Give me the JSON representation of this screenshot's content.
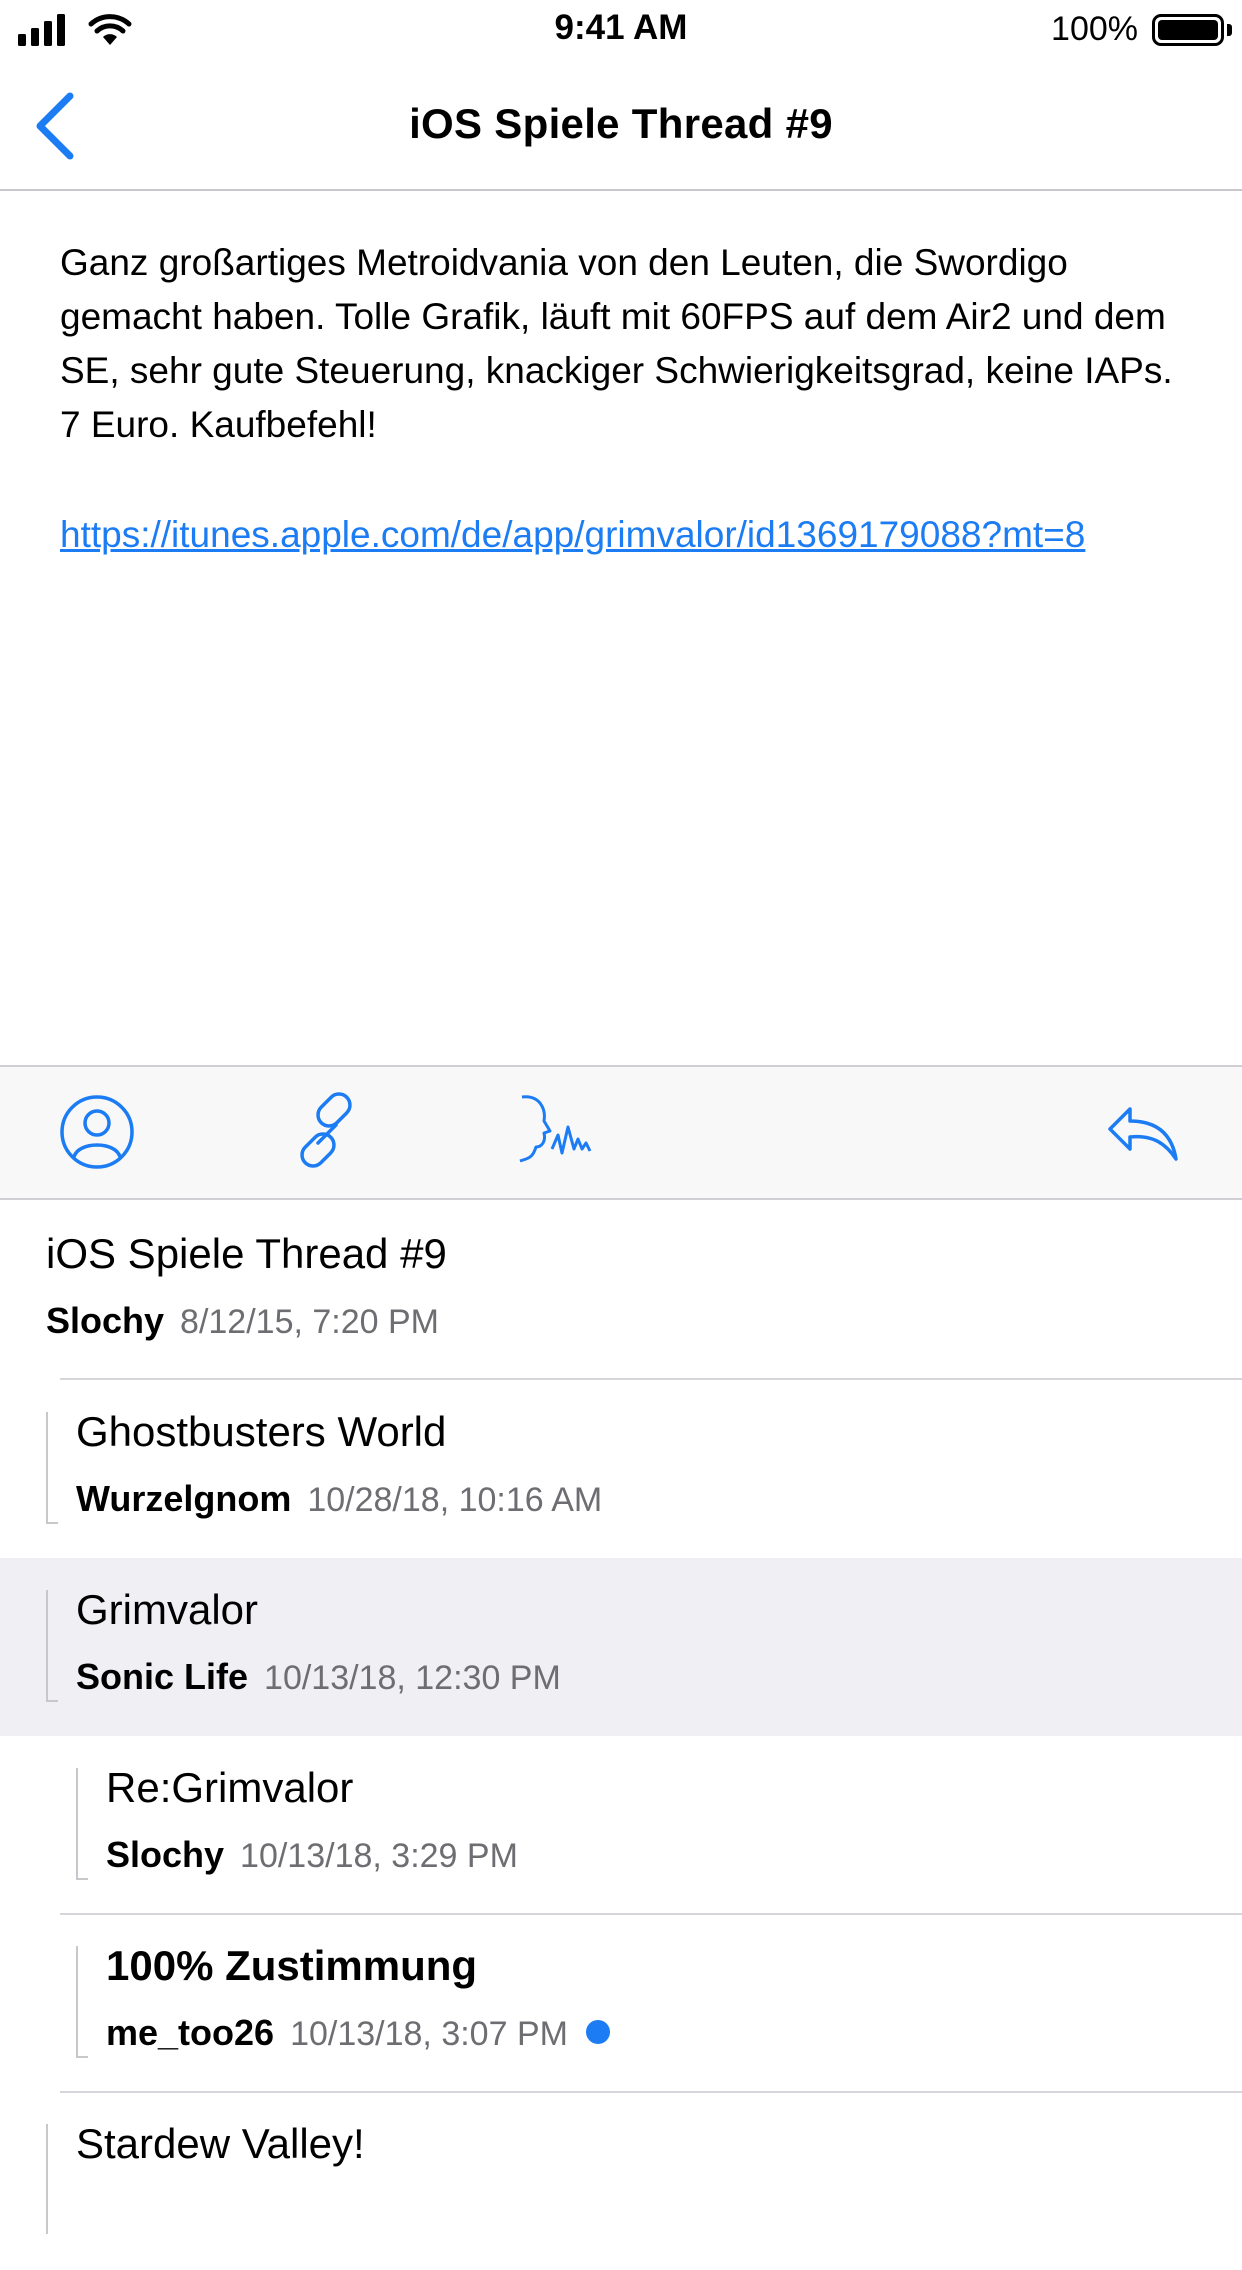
{
  "status_bar": {
    "time": "9:41 AM",
    "battery_percent": "100%"
  },
  "nav": {
    "title": "iOS Spiele Thread #9",
    "back_icon": "chevron-left-icon"
  },
  "post": {
    "body": "Ganz großartiges Metroidvania von den Leuten, die Swordigo gemacht haben. Tolle Grafik, läuft mit 60FPS auf dem Air2 und dem SE, sehr gute Steuerung, knackiger Schwierigkeitsgrad, keine IAPs. 7 Euro. Kaufbefehl!",
    "link": "https://itunes.apple.com/de/app/grimvalor/id1369179088?mt=8"
  },
  "toolbar": {
    "buttons": [
      "profile-icon",
      "link-icon",
      "speak-icon",
      "reply-icon"
    ]
  },
  "colors": {
    "accent": "#1b7cf3",
    "selected_row": "#efeff4",
    "secondary_text": "#6d6d72"
  },
  "threads": [
    {
      "title": "iOS Spiele Thread #9",
      "author": "Slochy",
      "date": "8/12/15, 7:20 PM",
      "level": 0,
      "selected": false,
      "unread": false
    },
    {
      "title": "Ghostbusters World",
      "author": "Wurzelgnom",
      "date": "10/28/18, 10:16 AM",
      "level": 1,
      "selected": false,
      "unread": false
    },
    {
      "title": "Grimvalor",
      "author": "Sonic Life",
      "date": "10/13/18, 12:30 PM",
      "level": 1,
      "selected": true,
      "unread": false
    },
    {
      "title": "Re:Grimvalor",
      "author": "Slochy",
      "date": "10/13/18, 3:29 PM",
      "level": 2,
      "selected": false,
      "unread": false
    },
    {
      "title": "100% Zustimmung",
      "author": "me_too26",
      "date": "10/13/18, 3:07 PM",
      "level": 2,
      "selected": false,
      "unread": true
    },
    {
      "title": "Stardew Valley!",
      "author": "",
      "date": "",
      "level": 1,
      "selected": false,
      "unread": false
    }
  ]
}
